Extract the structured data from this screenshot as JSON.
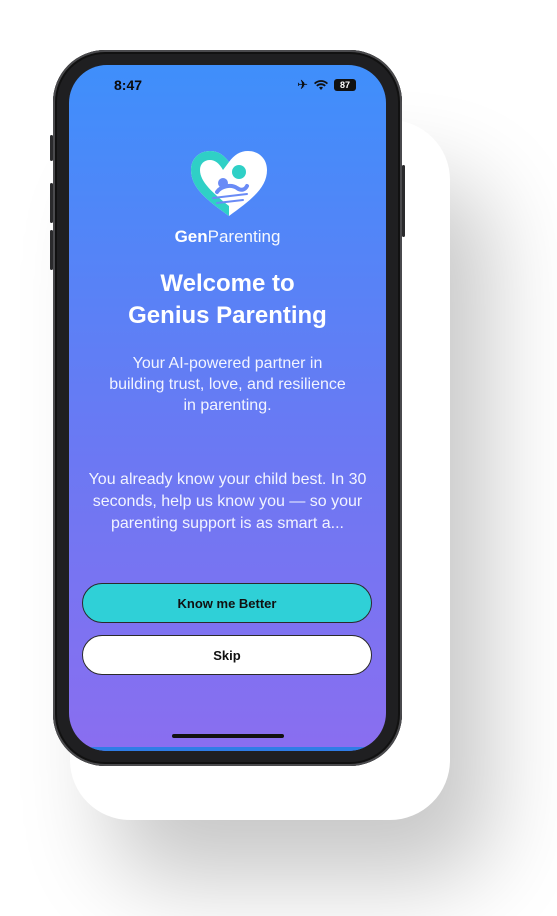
{
  "status_bar": {
    "time": "8:47",
    "battery": "87"
  },
  "brand": {
    "part1": "Gen",
    "part2": "Parenting"
  },
  "welcome": {
    "line1": "Welcome to",
    "line2": "Genius Parenting"
  },
  "subtitle": "Your AI-powered partner in building trust, love, and resilience in parenting.",
  "body": "You already know your child best. In 30 seconds, help us know you — so your parenting support is as smart a...",
  "buttons": {
    "primary": "Know me Better",
    "skip": "Skip"
  },
  "colors": {
    "gradient_top": "#3f8ffb",
    "gradient_bottom": "#8a6ef0",
    "primary_button": "#2fd0d7",
    "logo_teal": "#2fd0c6"
  }
}
